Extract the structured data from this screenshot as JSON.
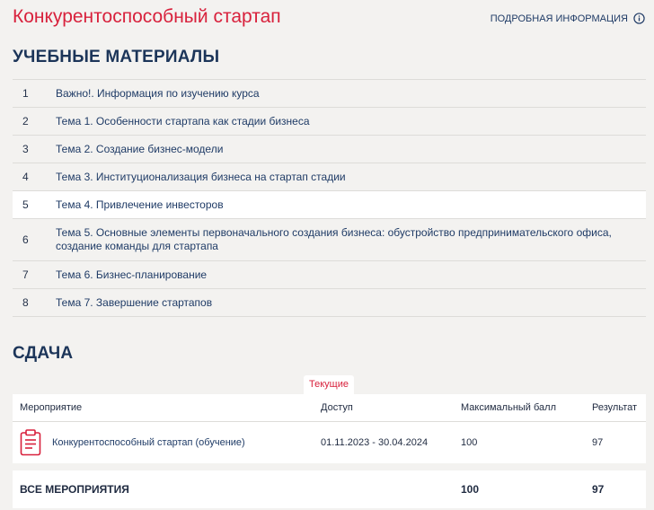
{
  "header": {
    "course_title": "Конкурентоспособный стартап",
    "more_info_label": "ПОДРОБНАЯ ИНФОРМАЦИЯ",
    "info_icon": "info-circle-icon"
  },
  "materials": {
    "title": "УЧЕБНЫЕ МАТЕРИАЛЫ",
    "items": [
      {
        "num": "1",
        "label": "Важно!. Информация по изучению курса"
      },
      {
        "num": "2",
        "label": "Тема 1. Особенности стартапа как стадии бизнеса"
      },
      {
        "num": "3",
        "label": "Тема 2. Создание бизнес-модели"
      },
      {
        "num": "4",
        "label": "Тема 3. Институционализация бизнеса на стартап стадии"
      },
      {
        "num": "5",
        "label": "Тема 4. Привлечение инвесторов"
      },
      {
        "num": "6",
        "label": "Тема 5. Основные элементы первоначального создания бизнеса: обустройство предпринимательского офиса, создание команды для стартапа"
      },
      {
        "num": "7",
        "label": "Тема 6. Бизнес-планирование"
      },
      {
        "num": "8",
        "label": "Тема 7. Завершение стартапов"
      }
    ]
  },
  "submission": {
    "title": "СДАЧА",
    "tab_current": "Текущие",
    "columns": {
      "event": "Мероприятие",
      "access": "Доступ",
      "max_score": "Максимальный балл",
      "result": "Результат"
    },
    "rows": [
      {
        "icon": "clipboard-icon",
        "event": "Конкурентоспособный стартап (обучение)",
        "access": "01.11.2023 - 30.04.2024",
        "max_score": "100",
        "result": "97"
      }
    ],
    "total": {
      "label": "ВСЕ МЕРОПРИЯТИЯ",
      "max_score": "100",
      "result": "97"
    }
  },
  "colors": {
    "accent_red": "#d8213c",
    "text_navy": "#1f3b66",
    "background": "#f3f2f0"
  }
}
